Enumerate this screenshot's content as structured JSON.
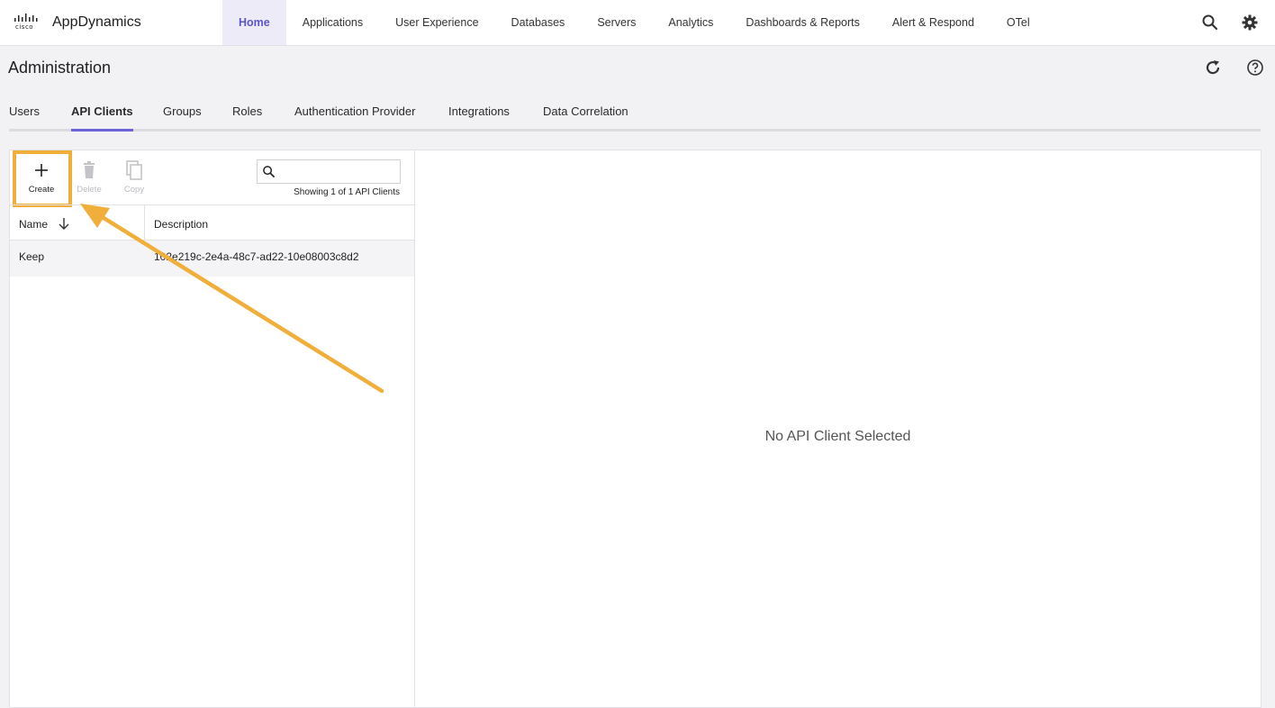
{
  "brand": {
    "vendor_word": "cisco",
    "app_name": "AppDynamics"
  },
  "nav": {
    "items": [
      {
        "label": "Home",
        "active": true
      },
      {
        "label": "Applications"
      },
      {
        "label": "User Experience"
      },
      {
        "label": "Databases"
      },
      {
        "label": "Servers"
      },
      {
        "label": "Analytics"
      },
      {
        "label": "Dashboards & Reports"
      },
      {
        "label": "Alert & Respond"
      },
      {
        "label": "OTel"
      }
    ],
    "icons": [
      "search-icon",
      "gear-icon"
    ]
  },
  "page": {
    "title": "Administration",
    "icons": [
      "refresh-icon",
      "help-icon"
    ]
  },
  "tabs": [
    {
      "label": "Users"
    },
    {
      "label": "API Clients",
      "active": true
    },
    {
      "label": "Groups"
    },
    {
      "label": "Roles"
    },
    {
      "label": "Authentication Provider"
    },
    {
      "label": "Integrations"
    },
    {
      "label": "Data Correlation"
    }
  ],
  "toolbar": {
    "create_label": "Create",
    "delete_label": "Delete",
    "copy_label": "Copy",
    "search_value": "",
    "showing_text": "Showing 1 of 1 API Clients"
  },
  "table": {
    "columns": [
      "Name",
      "Description"
    ],
    "rows": [
      {
        "name": "Keep",
        "description": "102e219c-2e4a-48c7-ad22-10e08003c8d2"
      }
    ]
  },
  "detail": {
    "empty_message": "No API Client Selected"
  },
  "colors": {
    "accent": "#6b63d6",
    "highlight": "#f0ae3a"
  }
}
